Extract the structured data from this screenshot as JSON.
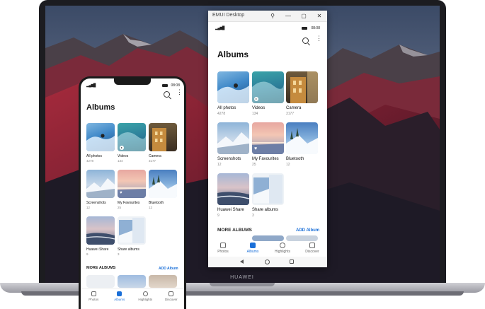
{
  "window": {
    "title": "EMUI Desktop",
    "controls": {
      "pin": "⚲",
      "minimize": "—",
      "maximize": "▢",
      "close": "✕"
    }
  },
  "laptop": {
    "brand": "HUAWEI"
  },
  "status": {
    "signal": "▂▄▆█",
    "time": "08:08"
  },
  "page": {
    "title": "Albums",
    "more_albums": "MORE ALBUMS",
    "add_album": "ADD Album"
  },
  "albums": [
    {
      "name": "All photos",
      "count": "4278"
    },
    {
      "name": "Videos",
      "count": "134"
    },
    {
      "name": "Camera",
      "count": "3177"
    },
    {
      "name": "Screenshots",
      "count": "12"
    },
    {
      "name": "My Favourites",
      "count": "25"
    },
    {
      "name": "Bluetooth",
      "count": "12"
    },
    {
      "name": "Huawei Share",
      "count": "9"
    },
    {
      "name": "Share albums",
      "count": "3"
    }
  ],
  "nav": [
    {
      "label": "Photos",
      "icon": "photo-icon"
    },
    {
      "label": "Albums",
      "icon": "albums-icon"
    },
    {
      "label": "Highlights",
      "icon": "highlights-icon"
    },
    {
      "label": "Discover",
      "icon": "discover-icon"
    }
  ],
  "colors": {
    "accent": "#1a6fd8",
    "bezel": "#1c1c20"
  }
}
